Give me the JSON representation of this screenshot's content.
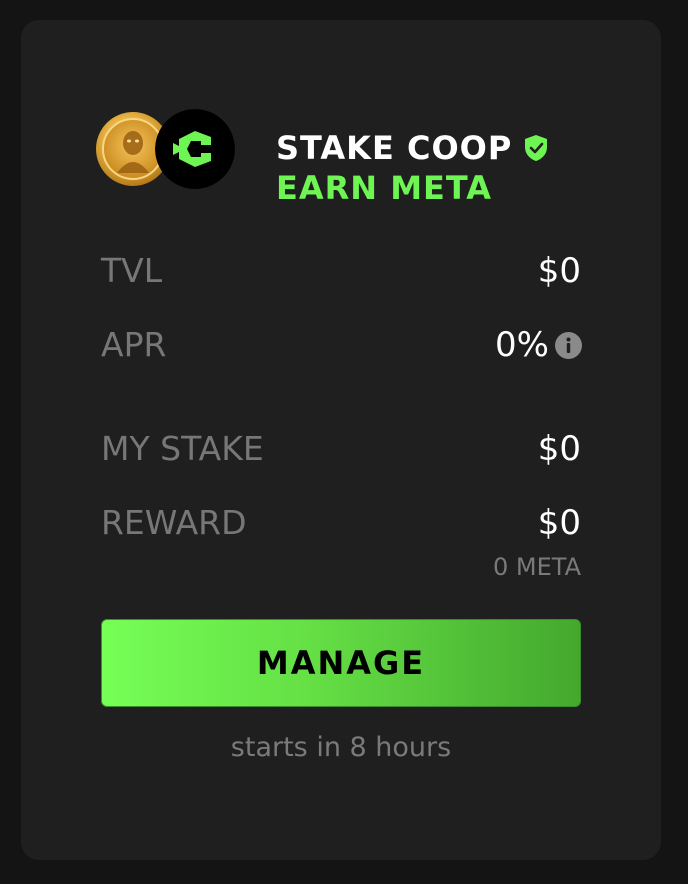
{
  "pool": {
    "title": "STAKE COOP",
    "subtitle": "EARN META"
  },
  "stats": {
    "tvl": {
      "label": "TVL",
      "value": "$0"
    },
    "apr": {
      "label": "APR",
      "value": "0%"
    },
    "my_stake": {
      "label": "MY STAKE",
      "value": "$0"
    },
    "reward": {
      "label": "REWARD",
      "value": "$0",
      "sub_value": "0 META"
    }
  },
  "actions": {
    "manage_label": "MANAGE"
  },
  "footer": {
    "note": "starts in 8 hours"
  },
  "colors": {
    "accent": "#6ff553",
    "card": "#1f1f1f",
    "background": "#141414",
    "muted": "#777777"
  },
  "icons": {
    "token_a": "meta-coin-icon",
    "token_b": "coop-logo-icon",
    "verified": "verified-shield-icon",
    "info": "info-icon"
  }
}
